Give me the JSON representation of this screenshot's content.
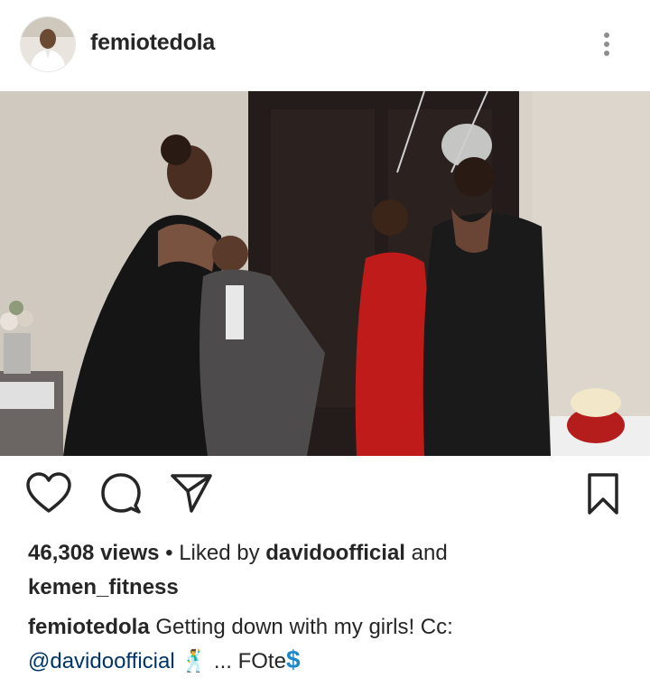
{
  "post": {
    "username": "femiotedola",
    "views": "46,308 views",
    "liked_by_prefix": "Liked by",
    "liked_by_user1": "davidoofficial",
    "liked_by_and": "and",
    "liked_by_user2": "kemen_fitness",
    "caption_user": "femiotedola",
    "caption_text": "Getting down with my girls! Cc:",
    "caption_mention": "@davidoofficial",
    "caption_emoji": "🕺",
    "caption_rest": "... FOte",
    "caption_dollar": "$"
  },
  "icons": {
    "more": "more-vertical-icon",
    "like": "heart-icon",
    "comment": "comment-icon",
    "share": "paper-plane-icon",
    "save": "bookmark-icon"
  },
  "colors": {
    "text": "#262626",
    "mention": "#003569",
    "icon": "#262626",
    "dots": "#8e8e8e"
  }
}
